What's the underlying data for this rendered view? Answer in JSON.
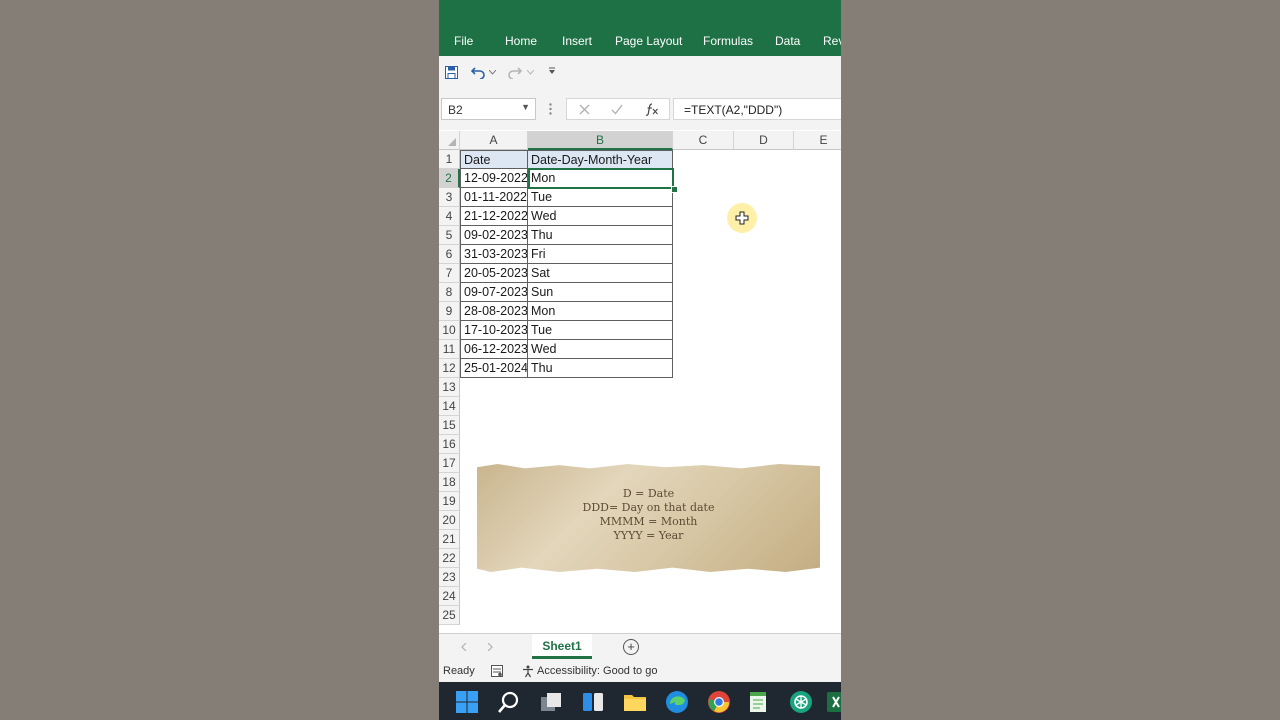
{
  "ribbon": {
    "tabs": [
      "File",
      "Home",
      "Insert",
      "Page Layout",
      "Formulas",
      "Data",
      "Rev"
    ]
  },
  "formula_bar": {
    "name_box": "B2",
    "formula": "=TEXT(A2,\"DDD\")"
  },
  "grid": {
    "columns": [
      "A",
      "B",
      "C",
      "D",
      "E"
    ],
    "rows": [
      "1",
      "2",
      "3",
      "4",
      "5",
      "6",
      "7",
      "8",
      "9",
      "10",
      "11",
      "12",
      "13",
      "14",
      "15",
      "16",
      "17",
      "18",
      "19",
      "20",
      "21",
      "22",
      "23",
      "24",
      "25"
    ],
    "data": [
      [
        "Date",
        "Date-Day-Month-Year"
      ],
      [
        "12-09-2022",
        "Mon"
      ],
      [
        "01-11-2022",
        "Tue"
      ],
      [
        "21-12-2022",
        "Wed"
      ],
      [
        "09-02-2023",
        "Thu"
      ],
      [
        "31-03-2023",
        "Fri"
      ],
      [
        "20-05-2023",
        "Sat"
      ],
      [
        "09-07-2023",
        "Sun"
      ],
      [
        "28-08-2023",
        "Mon"
      ],
      [
        "17-10-2023",
        "Tue"
      ],
      [
        "06-12-2023",
        "Wed"
      ],
      [
        "25-01-2024",
        "Thu"
      ]
    ],
    "active_cell": "B2"
  },
  "note": {
    "lines": [
      "D = Date",
      "DDD= Day on that date",
      "MMMM = Month",
      "YYYY = Year"
    ]
  },
  "sheet_tabs": {
    "active": "Sheet1",
    "add_symbol": "+"
  },
  "status": {
    "ready": "Ready",
    "accessibility": "Accessibility: Good to go"
  },
  "colors": {
    "excel_green": "#1e7145",
    "accent_green": "#217346",
    "header_fill": "#dde7f3",
    "taskbar": "#1f2730"
  }
}
